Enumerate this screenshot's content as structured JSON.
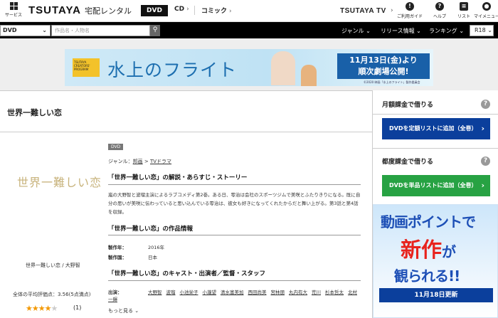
{
  "header": {
    "services_label": "サービス",
    "logo": "TSUTAYA",
    "logo_sub": "宅配レンタル",
    "nav": [
      {
        "label": "DVD",
        "active": true
      },
      {
        "label": "CD"
      },
      {
        "label": "コミック"
      }
    ],
    "tv_logo": "TSUTAYA TV",
    "icons": [
      {
        "icon": "user-guide-icon",
        "label": "ご利用ガイド"
      },
      {
        "icon": "help-icon",
        "label": "ヘルプ"
      },
      {
        "icon": "list-icon",
        "label": "リスト"
      },
      {
        "icon": "my-menu-icon",
        "label": "マイメニュー"
      }
    ]
  },
  "searchbar": {
    "category": "DVD",
    "placeholder": "作品名・人物名",
    "links": [
      "ジャンル",
      "リリース情報",
      "ランキング"
    ],
    "r18": "R18"
  },
  "banner": {
    "program": "TSUTAYA CREATORS' PROGRAM",
    "title": "水上のフライト",
    "release_line1": "11月13日(金)より",
    "release_line2": "順次劇場公開!",
    "credit": "©2020 映画「水上のフライト」製作委員会"
  },
  "product": {
    "title": "世界一難しい恋",
    "thumb_title": "世界一難しい恋",
    "cast_caption": "世界一難しい恋 / 大野智",
    "avg_rating_text": "全体の平均評価点：3.56(5点満点)",
    "rating": 3.56,
    "review_count": "(1)",
    "badge": "DVD",
    "genre_label": "ジャンル：",
    "genre_links": [
      "邦画",
      "TVドラマ"
    ],
    "sec_story": "「世界一難しい恋」の解説・あらすじ・ストーリー",
    "story": "嵐の大野智と波瑠主演によるラブコメディ第2巻。ある日、零治は会社のスポーツジムで美咲とふたりきりになる。既に自分の思いが美咲に伝わっていると思い込んでいる零治は、彼女も好きになってくれたからだと舞い上がる。第3話と第4話を収録。",
    "sec_info": "「世界一難しい恋」の作品情報",
    "info": [
      {
        "label": "製作年：",
        "value": "2016年"
      },
      {
        "label": "製作国：",
        "value": "日本"
      }
    ],
    "sec_cast": "「世界一難しい恋」のキャスト・出演者／監督・スタッフ",
    "cast_label": "出演：",
    "cast": [
      "大野智",
      "波瑠",
      "小池栄子",
      "小瀧望",
      "清水富美加",
      "西田尚美",
      "宮林朋",
      "丸内有大",
      "荒川",
      "杉本哲太",
      "北村一輝"
    ],
    "more": "もっと見る"
  },
  "sidebar": {
    "monthly_title": "月額課金で借りる",
    "monthly_button": "DVDを定額リストに追加（全巻）",
    "single_title": "都度課金で借りる",
    "single_button": "DVDを単品リストに追加（全巻）",
    "ad": {
      "line1": "動画ポイントで",
      "line2": "新作",
      "line2b": "が",
      "line3": "観られる!!",
      "line4": "11月18日更新"
    }
  },
  "colors": {
    "accent_blue": "#0b3f9c",
    "accent_green": "#27a243",
    "star": "#f39800"
  }
}
